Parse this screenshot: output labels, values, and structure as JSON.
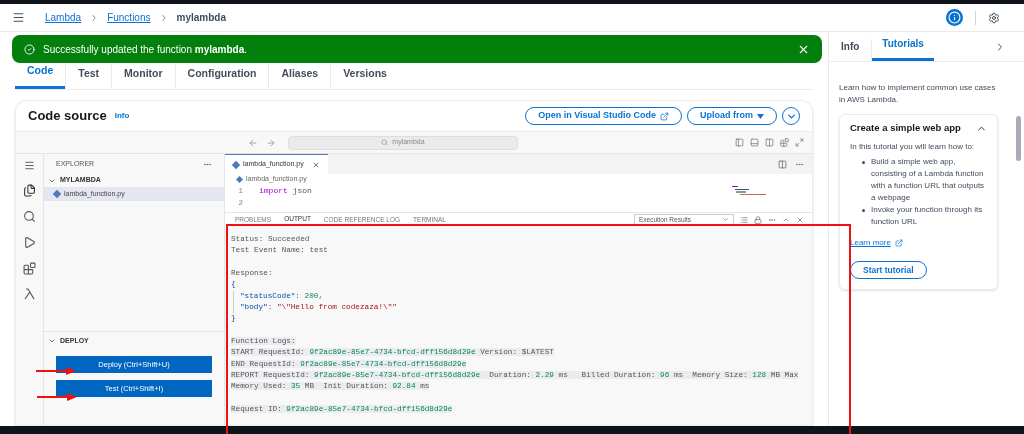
{
  "breadcrumb": [
    {
      "label": "Lambda",
      "kind": "link"
    },
    {
      "label": "Functions",
      "kind": "link"
    },
    {
      "label": "mylambda",
      "kind": "current"
    }
  ],
  "flash": {
    "text": "Successfully updated the function **mylambda**."
  },
  "tabs": [
    {
      "label": "Code",
      "selected": true
    },
    {
      "label": "Test",
      "selected": false
    },
    {
      "label": "Monitor",
      "selected": false
    },
    {
      "label": "Configuration",
      "selected": false
    },
    {
      "label": "Aliases",
      "selected": false
    },
    {
      "label": "Versions",
      "selected": false
    }
  ],
  "code_source": {
    "title": "Code source",
    "info": "Info",
    "buttons": [
      {
        "label": "Open in Visual Studio Code",
        "kind": "external"
      },
      {
        "label": "Upload from",
        "kind": "dropdown"
      }
    ]
  },
  "ide": {
    "search": "mylambda",
    "explorer": {
      "title": "EXPLORER",
      "folder": "MYLAMBDA",
      "files": [
        {
          "name": "lambda_function.py",
          "selected": true
        }
      ]
    },
    "deploy": {
      "title": "DEPLOY",
      "buttons": [
        "Deploy (Ctrl+Shift+U)",
        "Test (Ctrl+Shift+I)"
      ]
    },
    "editor_tab": "lambda_function.py",
    "editor_breadcrumb": "lambda_function.py",
    "lines": [
      {
        "number": "1",
        "tokens": [
          {
            "kind": "keyword",
            "text": "import"
          },
          {
            "kind": "plain",
            "text": " json"
          }
        ]
      },
      {
        "number": "2"
      }
    ],
    "panel_tabs": [
      {
        "label": "PROBLEMS",
        "selected": false
      },
      {
        "label": "OUTPUT",
        "selected": true
      },
      {
        "label": "CODE REFERENCE LOG",
        "selected": false
      },
      {
        "label": "TERMINAL",
        "selected": false
      }
    ],
    "output_select": "Execution Results",
    "output": [
      {
        "highlighted": false,
        "lines": [
          {
            "kind": "plain",
            "tokens": [
              {
                "kind": "plain",
                "text": "Status: Succeeded"
              }
            ]
          },
          {
            "kind": "plain",
            "tokens": [
              {
                "kind": "plain",
                "text": "Test Event Name: test"
              }
            ]
          }
        ]
      },
      {
        "highlighted": false,
        "lines": [
          {
            "kind": "plain",
            "tokens": [
              {
                "kind": "plain",
                "text": "Response:"
              }
            ]
          },
          {
            "kind": "plain",
            "tokens": [
              {
                "kind": "key",
                "text": "{"
              }
            ]
          },
          {
            "kind": "nested",
            "tokens": [
              {
                "kind": "key",
                "text": "\"statusCode\""
              },
              {
                "kind": "plain",
                "text": ": "
              },
              {
                "kind": "number",
                "text": "200"
              },
              {
                "kind": "plain",
                "text": ","
              }
            ]
          },
          {
            "kind": "nested",
            "tokens": [
              {
                "kind": "key",
                "text": "\"body\""
              },
              {
                "kind": "plain",
                "text": ": "
              },
              {
                "kind": "string",
                "text": "\"\\\"Hello from codezaza!\\\"\""
              }
            ]
          },
          {
            "kind": "plain",
            "tokens": [
              {
                "kind": "key",
                "text": "}"
              }
            ]
          }
        ]
      },
      {
        "highlighted": true,
        "lines": [
          {
            "kind": "plain",
            "tokens": [
              {
                "kind": "plain",
                "text": "Function Logs:"
              }
            ]
          },
          {
            "kind": "plain",
            "tokens": [
              {
                "kind": "plain",
                "text": "START RequestId: "
              },
              {
                "kind": "number",
                "text": "9f2ac89e-85e7-4734-bfcd-dff156d8d29e"
              },
              {
                "kind": "plain",
                "text": " Version: $LATEST"
              }
            ]
          },
          {
            "kind": "plain",
            "tokens": [
              {
                "kind": "plain",
                "text": "END RequestId: "
              },
              {
                "kind": "number",
                "text": "9f2ac89e-85e7-4734-bfcd-dff156d8d29e"
              }
            ]
          },
          {
            "kind": "plain",
            "tokens": [
              {
                "kind": "plain",
                "text": "REPORT RequestId: "
              },
              {
                "kind": "number",
                "text": "9f2ac89e-85e7-4734-bfcd-dff156d8d29e"
              },
              {
                "kind": "plain",
                "text": "  Duration: "
              },
              {
                "kind": "number",
                "text": "2.29"
              },
              {
                "kind": "plain",
                "text": " ms   Billed Duration: "
              },
              {
                "kind": "number",
                "text": "96"
              },
              {
                "kind": "plain",
                "text": " ms  Memory Size: "
              },
              {
                "kind": "number",
                "text": "128"
              },
              {
                "kind": "plain",
                "text": " MB Max"
              }
            ]
          },
          {
            "kind": "plain",
            "tokens": [
              {
                "kind": "plain",
                "text": "Memory Used: "
              },
              {
                "kind": "number",
                "text": "35"
              },
              {
                "kind": "plain",
                "text": " MB  Init Duration: "
              },
              {
                "kind": "number",
                "text": "92.84"
              },
              {
                "kind": "plain",
                "text": " ms"
              }
            ]
          }
        ]
      },
      {
        "highlighted": true,
        "lines": [
          {
            "kind": "plain",
            "tokens": [
              {
                "kind": "plain",
                "text": "Request ID: "
              },
              {
                "kind": "number",
                "text": "9f2ac89e-85e7-4734-bfcd-dff156d8d29e"
              }
            ]
          }
        ]
      }
    ]
  },
  "side_panel": {
    "tabs": [
      {
        "label": "Info",
        "selected": false
      },
      {
        "label": "Tutorials",
        "selected": true
      }
    ],
    "intro": "Learn how to implement common use cases in AWS Lambda.",
    "tutorial": {
      "title": "Create a simple web app",
      "expanded": true,
      "lead": "In this tutorial you will learn how to:",
      "bullets": [
        "Build a simple web app, consisting of a Lambda function with a function URL that outputs a webpage",
        "Invoke your function through its function URL"
      ],
      "link": "Learn more",
      "button": "Start tutorial"
    }
  }
}
